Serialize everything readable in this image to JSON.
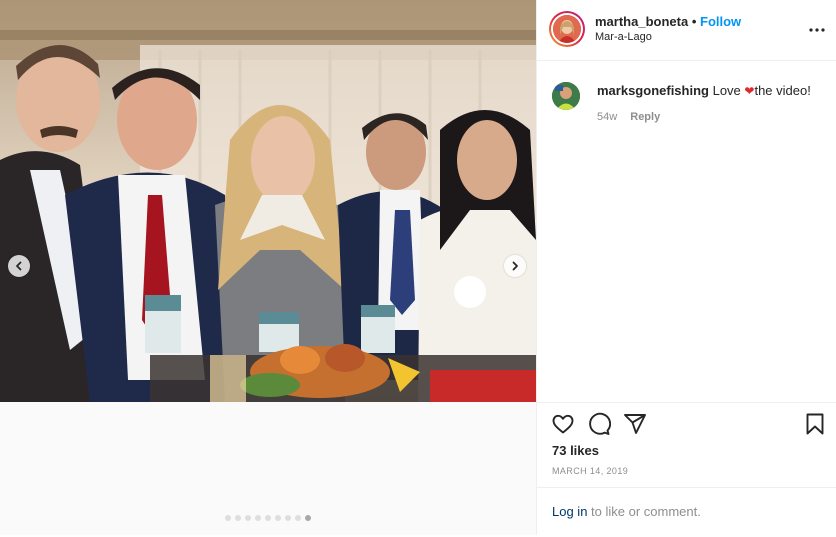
{
  "post": {
    "username": "martha_boneta",
    "separator": "•",
    "follow_label": "Follow",
    "location": "Mar-a-Lago"
  },
  "comment": {
    "username": "marksgonefishing",
    "text_before": "Love ",
    "emoji": "❤",
    "text_after": "the video!",
    "age": "54w",
    "reply_label": "Reply"
  },
  "stats": {
    "likes": "73 likes",
    "date": "MARCH 14, 2019"
  },
  "login": {
    "link_label": "Log in",
    "suffix": " to like or comment."
  },
  "carousel": {
    "dot_count": 9,
    "active_dot": 8
  },
  "icons": {
    "more": "more-options-icon",
    "like": "heart-icon",
    "comment": "comment-icon",
    "share": "share-icon",
    "save": "bookmark-icon",
    "prev": "chevron-left-icon",
    "next": "chevron-right-icon"
  },
  "colors": {
    "accent": "#0095f6",
    "link": "#00376b",
    "muted": "#8e8e8e",
    "text": "#262626",
    "heart": "#e02b2b"
  }
}
